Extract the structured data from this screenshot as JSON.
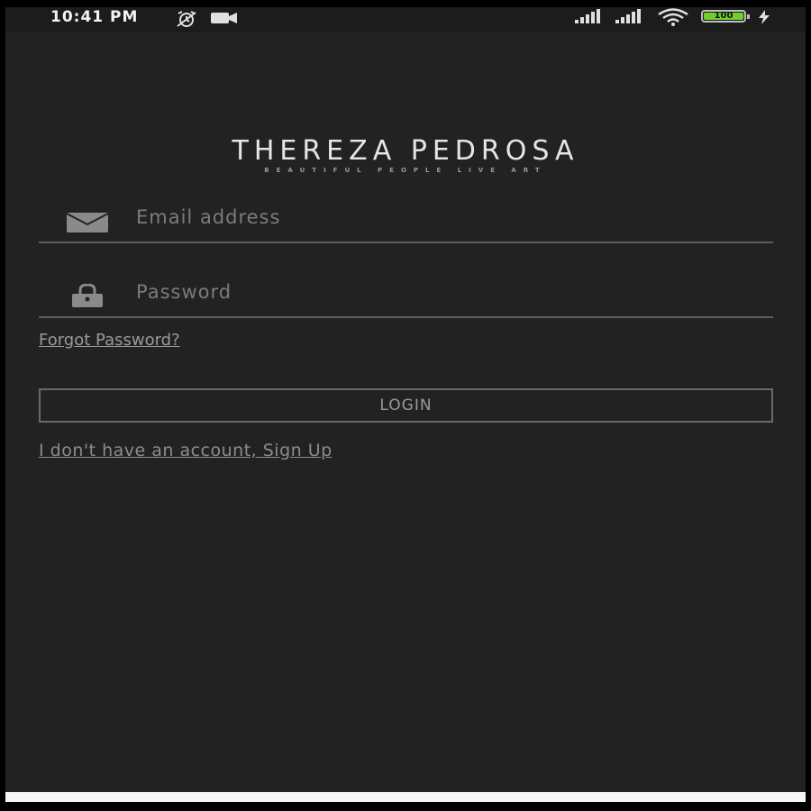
{
  "status_bar": {
    "time": "10:41 PM",
    "icons": [
      "alarm-off-icon",
      "video-camera-icon",
      "signal-icon",
      "signal-icon",
      "wifi-icon",
      "battery-icon",
      "charging-bolt-icon"
    ],
    "battery_level": "100",
    "battery_color": "#6fcf2b"
  },
  "brand": {
    "name": "THEREZA PEDROSA",
    "tagline": "BEAUTIFUL PEOPLE LIVE ART"
  },
  "login_form": {
    "email_placeholder": "Email address",
    "email_icon": "envelope-icon",
    "password_placeholder": "Password",
    "password_icon": "lock-icon",
    "forgot_password": "Forgot Password?",
    "login_label": "LOGIN",
    "signup_link": "I don't have an account, Sign Up"
  },
  "colors": {
    "background": "#222222",
    "text_muted": "#9a9a9a",
    "divider": "#5c5c5c"
  }
}
